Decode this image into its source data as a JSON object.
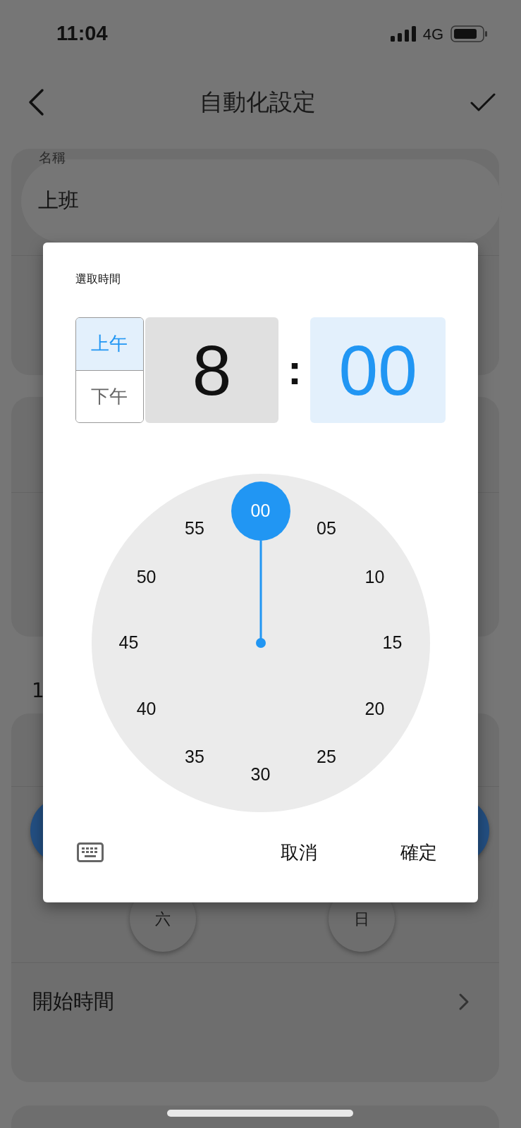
{
  "status_bar": {
    "time": "11:04",
    "network": "4G"
  },
  "nav": {
    "title": "自動化設定"
  },
  "name_field": {
    "label": "名稱",
    "value": "上班"
  },
  "section_label": "1",
  "days": [
    {
      "selected": true
    },
    {
      "selected": true
    },
    {
      "label": "六",
      "selected": false
    },
    {
      "label": "日",
      "selected": false
    }
  ],
  "start_time": {
    "label": "開始時間"
  },
  "dialog": {
    "title": "選取時間",
    "periods": [
      {
        "label": "上午",
        "selected": true
      },
      {
        "label": "下午",
        "selected": false
      }
    ],
    "hour": {
      "value": "8",
      "selected": false
    },
    "separator": ":",
    "minute": {
      "value": "00",
      "selected": true
    },
    "dial": [
      {
        "label": "00",
        "selected": true
      },
      {
        "label": "05",
        "selected": false
      },
      {
        "label": "10",
        "selected": false
      },
      {
        "label": "15",
        "selected": false
      },
      {
        "label": "20",
        "selected": false
      },
      {
        "label": "25",
        "selected": false
      },
      {
        "label": "30",
        "selected": false
      },
      {
        "label": "35",
        "selected": false
      },
      {
        "label": "40",
        "selected": false
      },
      {
        "label": "45",
        "selected": false
      },
      {
        "label": "50",
        "selected": false
      },
      {
        "label": "55",
        "selected": false
      }
    ],
    "buttons": [
      "取消",
      "確定"
    ]
  }
}
